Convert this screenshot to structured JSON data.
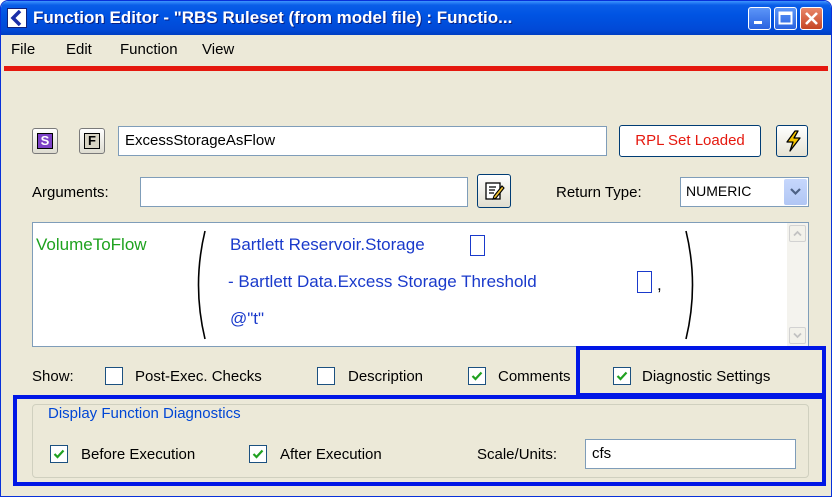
{
  "window": {
    "title": "Function Editor - \"RBS Ruleset (from model file) : Functio...",
    "minimize_label": "minimize",
    "maximize_label": "maximize",
    "close_label": "close"
  },
  "menu": {
    "items": [
      "File",
      "Edit",
      "Function",
      "View"
    ]
  },
  "toolbar": {
    "s_button": "S",
    "f_button": "F",
    "function_name": "ExcessStorageAsFlow",
    "rpl_status": "RPL Set Loaded"
  },
  "arguments": {
    "label": "Arguments:",
    "value": "",
    "return_type_label": "Return Type:",
    "return_type": "NUMERIC"
  },
  "expression": {
    "function": "VolumeToFlow",
    "line1": "Bartlett Reservoir.Storage",
    "line2": "- Bartlett Data.Excess Storage Threshold",
    "line2_suffix": ",",
    "line3": "@\"t\""
  },
  "show": {
    "label": "Show:",
    "options": [
      {
        "label": "Post-Exec. Checks",
        "checked": false
      },
      {
        "label": "Description",
        "checked": false
      },
      {
        "label": "Comments",
        "checked": true
      },
      {
        "label": "Diagnostic Settings",
        "checked": true
      }
    ]
  },
  "diagnostics": {
    "group_title": "Display Function Diagnostics",
    "before_label": "Before Execution",
    "before_checked": true,
    "after_label": "After Execution",
    "after_checked": true,
    "scale_label": "Scale/Units:",
    "scale_value": "cfs"
  },
  "colors": {
    "title_bar": "#0054e3",
    "accent_red": "#e5180e",
    "highlight_frame": "#0016e6",
    "function_green": "#1ea21e",
    "slot_blue": "#1a3acb"
  }
}
